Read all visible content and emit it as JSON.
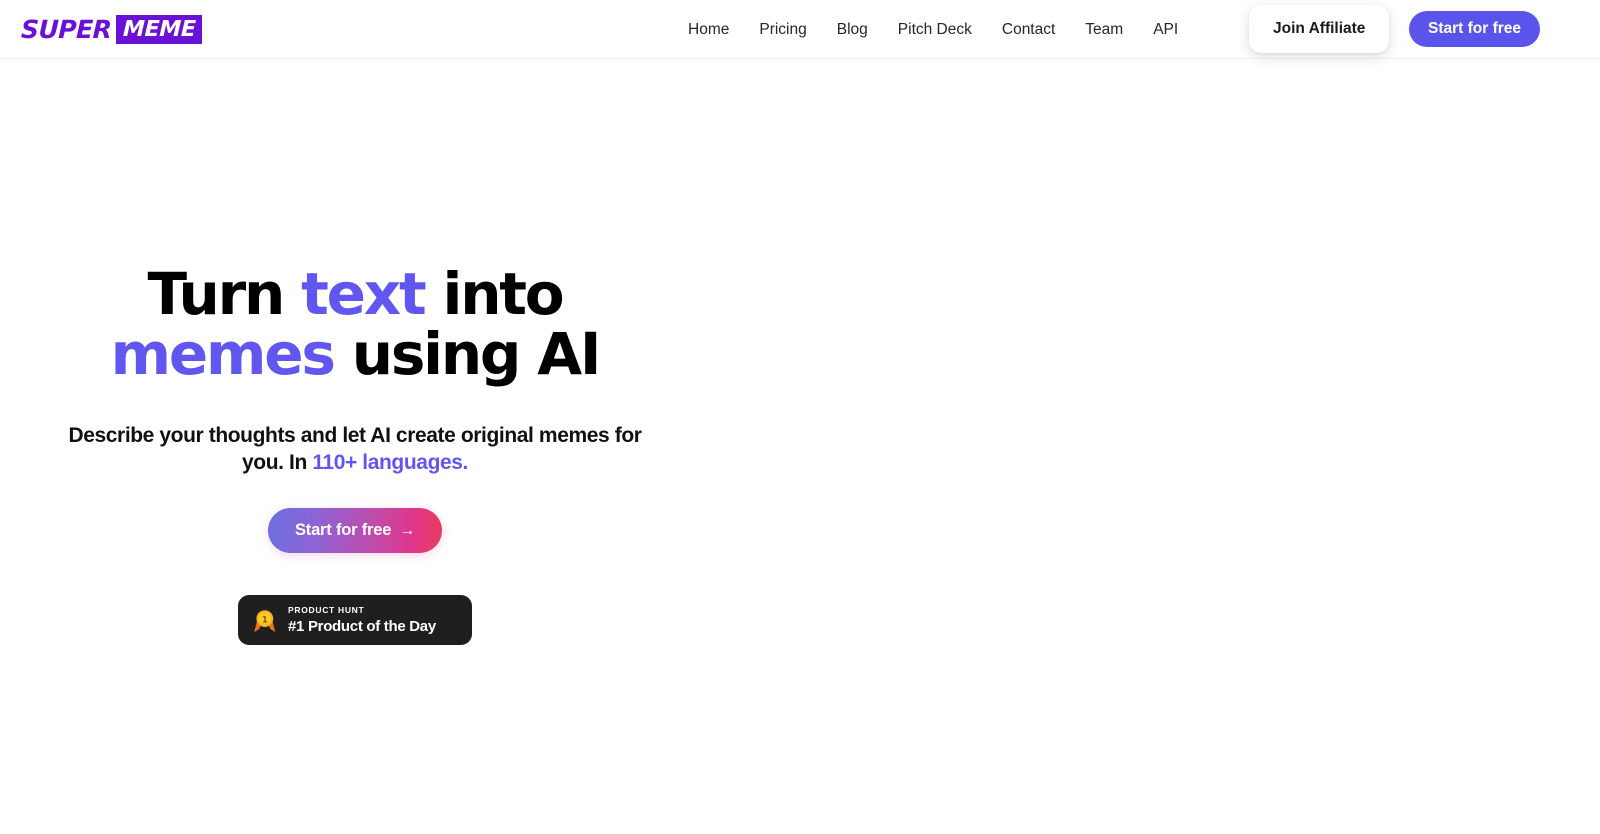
{
  "header": {
    "logo": {
      "word1": "SUPER",
      "word2": "MEME",
      "brand_color": "#6A11D6"
    },
    "nav_items": [
      {
        "label": "Home"
      },
      {
        "label": "Pricing"
      },
      {
        "label": "Blog"
      },
      {
        "label": "Pitch Deck"
      },
      {
        "label": "Contact"
      },
      {
        "label": "Team"
      },
      {
        "label": "API"
      }
    ],
    "affiliate_button": {
      "label": "Join Affiliate"
    },
    "start_button": {
      "label": "Start for free",
      "color": "#5B54EB"
    }
  },
  "hero": {
    "headline": {
      "part1": "Turn ",
      "accent1": "text",
      "part2": " into ",
      "accent2": "memes",
      "part3": " using AI",
      "accent_color": "#6156F0"
    },
    "subhead": {
      "text": "Describe your thoughts and let AI create original memes for you. In ",
      "highlight": "110+ languages.",
      "highlight_color": "#6156F0"
    },
    "cta": {
      "label": "Start for free",
      "arrow": "→",
      "gradient_from": "#6C6FE0",
      "gradient_to": "#E93B5C"
    },
    "badge": {
      "icon": "gold-medal-icon",
      "kicker": "PRODUCT HUNT",
      "title": "#1 Product of the Day",
      "background": "#1f1f20"
    }
  }
}
